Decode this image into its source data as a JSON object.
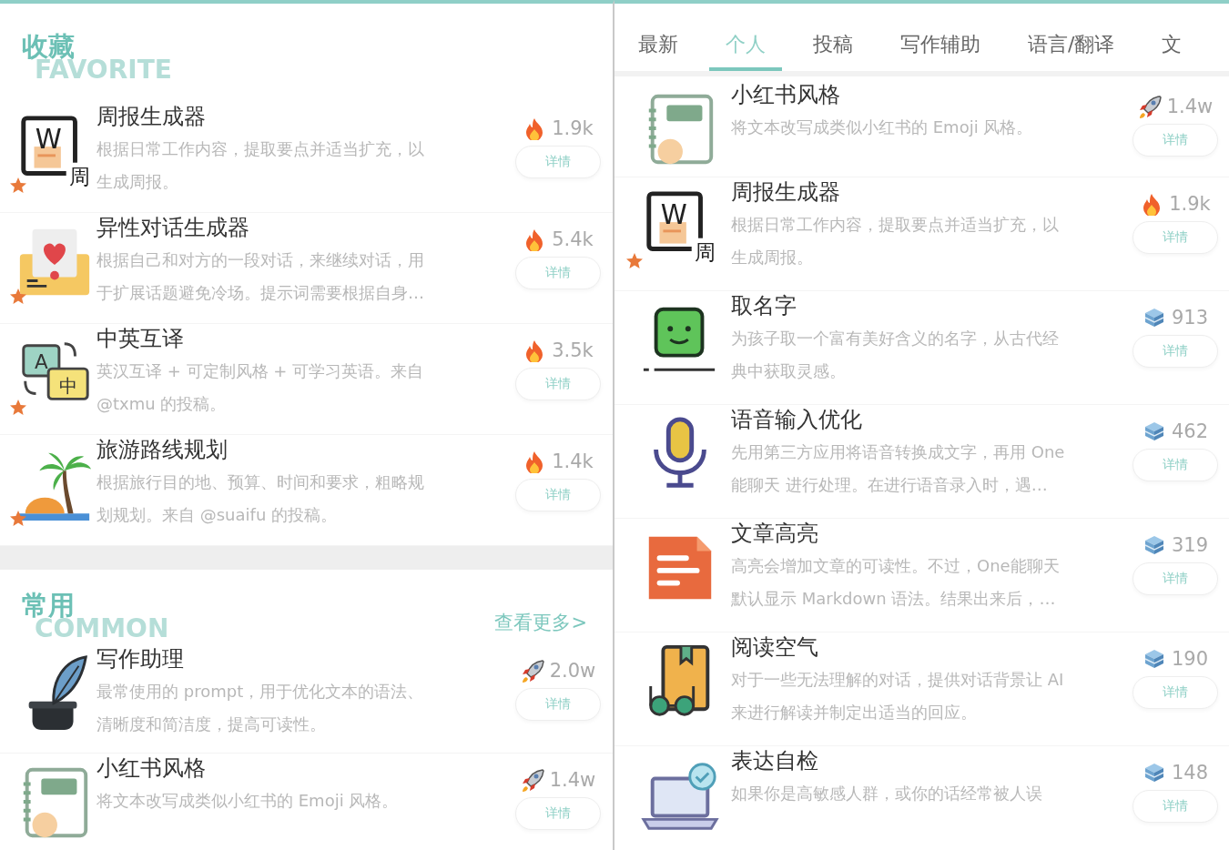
{
  "favorites": {
    "title": "收藏",
    "subtitle": "FAVORITE",
    "items": [
      {
        "icon_labels": [
          "W",
          "周"
        ],
        "starred": true,
        "title": "周报生成器",
        "desc_lines": [
          "根据日常工作内容，提取要点并适当扩充，以",
          "生成周报。"
        ],
        "kind": "hot",
        "count": "1.9k",
        "button": "详情"
      },
      {
        "starred": true,
        "title": "异性对话生成器",
        "desc_lines": [
          "根据自己和对方的一段对话，来继续对话，用",
          "于扩展话题避免冷场。提示词需要根据自身…"
        ],
        "kind": "hot",
        "count": "5.4k",
        "button": "详情"
      },
      {
        "icon_labels": [
          "A",
          "中"
        ],
        "starred": true,
        "title": "中英互译",
        "desc_lines": [
          "英汉互译 + 可定制风格 + 可学习英语。来自",
          "@txmu 的投稿。"
        ],
        "kind": "hot",
        "count": "3.5k",
        "button": "详情"
      },
      {
        "starred": true,
        "title": "旅游路线规划",
        "desc_lines": [
          "根据旅行目的地、预算、时间和要求，粗略规",
          "划规划。来自 @suaifu 的投稿。"
        ],
        "kind": "hot",
        "count": "1.4k",
        "button": "详情"
      }
    ]
  },
  "common": {
    "title": "常用",
    "subtitle": "COMMON",
    "more": "查看更多>",
    "items": [
      {
        "starred": false,
        "title": "写作助理",
        "desc_lines": [
          "最常使用的 prompt，用于优化文本的语法、",
          "清晰度和简洁度，提高可读性。"
        ],
        "kind": "rocket",
        "count": "2.0w",
        "button": "详情"
      },
      {
        "starred": false,
        "title": "小红书风格",
        "desc_lines": [
          "将文本改写成类似小红书的 Emoji 风格。"
        ],
        "kind": "rocket",
        "count": "1.4w",
        "button": "详情"
      }
    ]
  },
  "tabs": [
    {
      "label": "最新",
      "selected": false
    },
    {
      "label": "个人",
      "selected": true
    },
    {
      "label": "投稿",
      "selected": false
    },
    {
      "label": "写作辅助",
      "selected": false
    },
    {
      "label": "语言/翻译",
      "selected": false
    },
    {
      "label": "文",
      "selected": false
    }
  ],
  "list": [
    {
      "starred": false,
      "title": "小红书风格",
      "desc_lines": [
        "将文本改写成类似小红书的 Emoji 风格。"
      ],
      "kind": "rocket",
      "count": "1.4w",
      "button": "详情"
    },
    {
      "icon_labels": [
        "W",
        "周"
      ],
      "starred": true,
      "title": "周报生成器",
      "desc_lines": [
        "根据日常工作内容，提取要点并适当扩充，以",
        "生成周报。"
      ],
      "kind": "hot",
      "count": "1.9k",
      "button": "详情"
    },
    {
      "starred": false,
      "title": "取名字",
      "desc_lines": [
        "为孩子取一个富有美好含义的名字，从古代经",
        "典中获取灵感。"
      ],
      "kind": "cube",
      "count": "913",
      "button": "详情"
    },
    {
      "starred": false,
      "title": "语音输入优化",
      "desc_lines": [
        "先用第三方应用将语音转换成文字，再用 One",
        "能聊天 进行处理。在进行语音录入时，遇…"
      ],
      "kind": "cube",
      "count": "462",
      "button": "详情"
    },
    {
      "starred": false,
      "title": "文章高亮",
      "desc_lines": [
        "高亮会增加文章的可读性。不过，One能聊天",
        "默认显示 Markdown 语法。结果出来后，…"
      ],
      "kind": "cube",
      "count": "319",
      "button": "详情"
    },
    {
      "starred": false,
      "title": "阅读空气",
      "desc_lines": [
        "对于一些无法理解的对话，提供对话背景让 AI",
        "来进行解读并制定出适当的回应。"
      ],
      "kind": "cube",
      "count": "190",
      "button": "详情"
    },
    {
      "starred": false,
      "title": "表达自检",
      "desc_lines": [
        "如果你是高敏感人群，或你的话经常被人误"
      ],
      "kind": "cube",
      "count": "148",
      "button": "详情"
    }
  ]
}
